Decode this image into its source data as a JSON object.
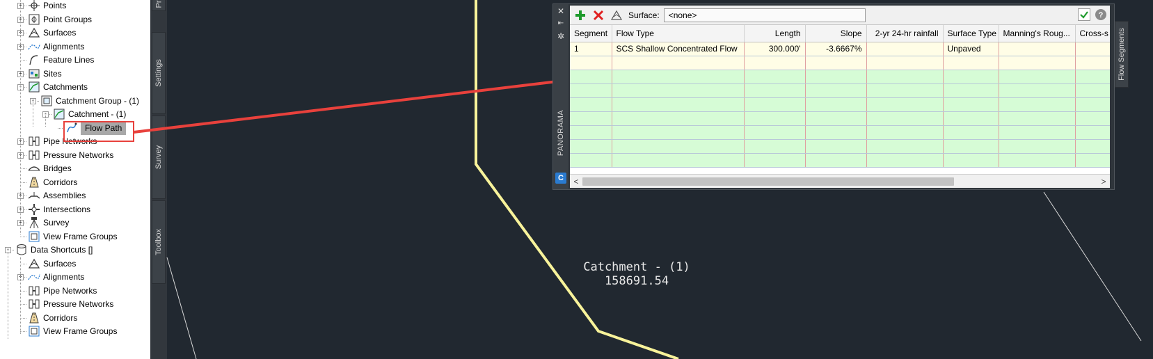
{
  "toolspace": {
    "tree": [
      {
        "label": "Points",
        "icon": "points-icon"
      },
      {
        "label": "Point Groups",
        "icon": "point-groups-icon"
      },
      {
        "label": "Surfaces",
        "icon": "surfaces-icon"
      },
      {
        "label": "Alignments",
        "icon": "alignments-icon"
      },
      {
        "label": "Feature Lines",
        "icon": "feature-lines-icon"
      },
      {
        "label": "Sites",
        "icon": "sites-icon"
      },
      {
        "label": "Catchments",
        "icon": "catchments-icon"
      },
      {
        "label": "Catchment Group - (1)",
        "icon": "catchment-group-icon"
      },
      {
        "label": "Catchment - (1)",
        "icon": "catchment-icon"
      },
      {
        "label": "Flow Path",
        "icon": "flow-path-icon"
      },
      {
        "label": "Pipe Networks",
        "icon": "pipe-networks-icon"
      },
      {
        "label": "Pressure Networks",
        "icon": "pressure-networks-icon"
      },
      {
        "label": "Bridges",
        "icon": "bridges-icon"
      },
      {
        "label": "Corridors",
        "icon": "corridors-icon"
      },
      {
        "label": "Assemblies",
        "icon": "assemblies-icon"
      },
      {
        "label": "Intersections",
        "icon": "intersections-icon"
      },
      {
        "label": "Survey",
        "icon": "survey-icon"
      },
      {
        "label": "View Frame Groups",
        "icon": "view-frame-groups-icon"
      },
      {
        "label": "Data Shortcuts []",
        "icon": "data-shortcuts-icon"
      },
      {
        "label": "Surfaces",
        "icon": "surfaces-icon"
      },
      {
        "label": "Alignments",
        "icon": "alignments-icon"
      },
      {
        "label": "Pipe Networks",
        "icon": "pipe-networks-icon"
      },
      {
        "label": "Pressure Networks",
        "icon": "pressure-networks-icon"
      },
      {
        "label": "Corridors",
        "icon": "corridors-icon"
      },
      {
        "label": "View Frame Groups",
        "icon": "view-frame-groups-icon"
      }
    ],
    "tabs": [
      "Pr",
      "Settings",
      "Survey",
      "Toolbox"
    ]
  },
  "panorama": {
    "title": "PANORAMA",
    "logo": "C",
    "side_tab": "Flow Segments",
    "toolbar": {
      "surface_label": "Surface:",
      "surface_value": "<none>"
    },
    "columns": [
      "Segment",
      "Flow Type",
      "Length",
      "Slope",
      "2-yr 24-hr rainfall",
      "Surface Type",
      "Manning's Roug...",
      "Cross-s"
    ],
    "rows": [
      [
        "1",
        "SCS Shallow Concentrated Flow",
        "300.000'",
        "-3.6667%",
        "",
        "Unpaved",
        "",
        ""
      ]
    ],
    "empty_row_count": 8,
    "scroll_left": "<",
    "scroll_right": ">"
  },
  "drawing": {
    "catchment_name": "Catchment - (1)",
    "catchment_area": "158691.54"
  },
  "colors": {
    "canvas_bg": "#212830",
    "flow_line": "#f8f39a",
    "arrow": "#e8413c",
    "highlight_box": "#e8413c"
  }
}
